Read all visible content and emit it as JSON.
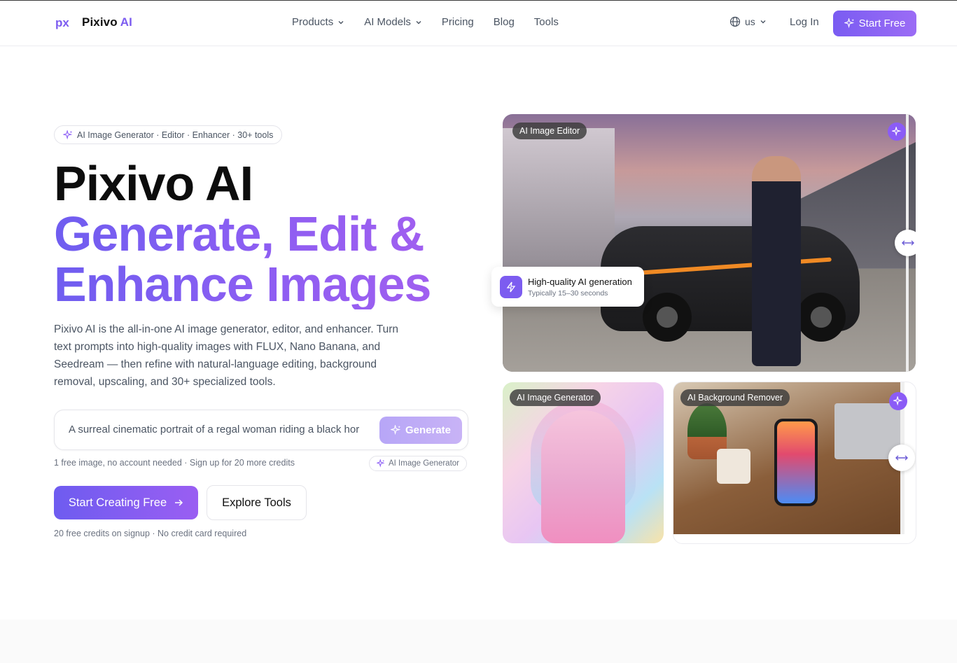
{
  "header": {
    "brand_name": "Pixivo",
    "brand_suffix": "AI",
    "nav": [
      {
        "label": "Products",
        "has_dropdown": true
      },
      {
        "label": "AI Models",
        "has_dropdown": true
      },
      {
        "label": "Pricing",
        "has_dropdown": false
      },
      {
        "label": "Blog",
        "has_dropdown": false
      },
      {
        "label": "Tools",
        "has_dropdown": false
      }
    ],
    "language": "us",
    "login_label": "Log In",
    "start_label": "Start Free"
  },
  "hero": {
    "pill_text": "AI Image Generator · Editor · Enhancer · 30+ tools",
    "title_line1": "Pixivo AI",
    "title_line2": "Generate, Edit &",
    "title_line3": "Enhance Images",
    "description": "Pixivo AI is the all-in-one AI image generator, editor, and enhancer. Turn text prompts into high-quality images with FLUX, Nano Banana, and Seedream — then refine with natural-language editing, background removal, upscaling, and 30+ specialized tools.",
    "prompt_value": "A surreal cinematic portrait of a regal woman riding a black hor",
    "generate_label": "Generate",
    "free_note": "1 free image, no account needed · Sign up for 20 more credits",
    "tool_chip": "AI Image Generator",
    "cta_primary": "Start Creating Free",
    "cta_secondary": "Explore Tools",
    "credits_note": "20 free credits on signup · No credit card required"
  },
  "showcase": {
    "main_tag": "AI Image Editor",
    "float_title": "High-quality AI generation",
    "float_sub": "Typically 15–30 seconds",
    "anime_tag": "AI Image Generator",
    "bg_tag": "AI Background Remover"
  },
  "colors": {
    "accent": "#7c5cf0",
    "accent_light": "#b7a6f7"
  }
}
